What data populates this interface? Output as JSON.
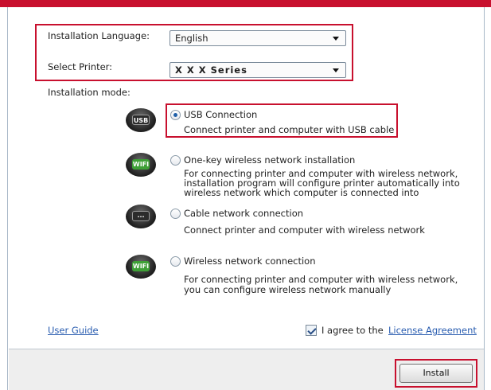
{
  "colors": {
    "highlight": "#c8102e",
    "link": "#2a5db0",
    "accent": "#1e5fa8"
  },
  "language": {
    "label": "Installation Language:",
    "value": "English"
  },
  "printer": {
    "label": "Select Printer:",
    "value": "X X X  Series"
  },
  "mode": {
    "label": "Installation mode:",
    "options": [
      {
        "icon": "usb-icon",
        "badge": "USB",
        "title": "USB Connection",
        "desc": [
          "Connect printer and computer with USB cable"
        ],
        "selected": true
      },
      {
        "icon": "wifi-icon",
        "badge": "WIFI",
        "title": "One-key wireless network installation",
        "desc": [
          "For connecting printer and computer with wireless network,",
          "installation program will configure printer automatically into",
          "wireless network which computer is connected into"
        ],
        "selected": false
      },
      {
        "icon": "ethernet-icon",
        "badge": "···",
        "title": "Cable network connection",
        "desc": [
          "Connect printer and computer with wireless network"
        ],
        "selected": false
      },
      {
        "icon": "wireless-icon",
        "badge": "WIFI",
        "title": "Wireless network connection",
        "desc": [
          "For connecting printer and computer with wireless network,",
          "you can configure wireless network manually"
        ],
        "selected": false
      }
    ]
  },
  "footer": {
    "user_guide": "User Guide",
    "agree_text": "I agree to the",
    "license_link": "License Agreement",
    "agree_checked": true,
    "install_label": "Install"
  }
}
